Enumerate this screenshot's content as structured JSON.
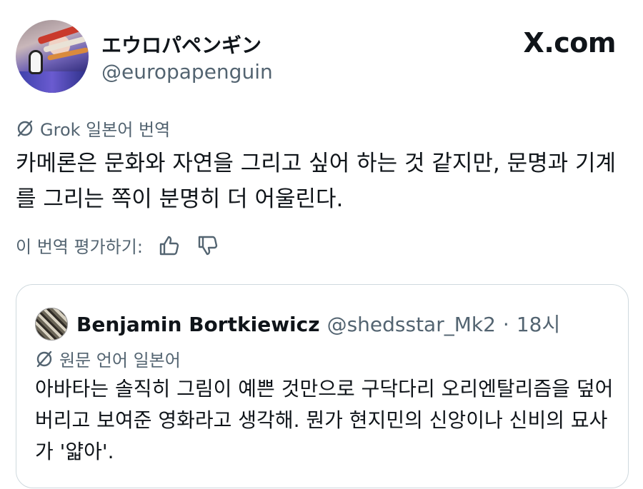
{
  "post": {
    "author": {
      "display_name": "エウロパペンギン",
      "handle": "@europapenguin"
    },
    "site_logo": "X.com",
    "translation_label": "Grok 일본어 번역",
    "translated_text": "카메론은 문화와 자연을 그리고 싶어 하는 것 같지만, 문명과 기계를 그리는 쪽이 분명히 더 어울린다.",
    "rate_label": "이 번역 평가하기:",
    "icons": {
      "grok": "grok-icon",
      "thumbs_up": "thumbs-up-icon",
      "thumbs_down": "thumbs-down-icon"
    }
  },
  "quoted": {
    "author": {
      "display_name": "Benjamin Bortkiewicz",
      "handle": "@shedsstar_Mk2",
      "separator": "·",
      "time": "18시"
    },
    "language_label": "원문 언어 일본어",
    "text": "아바타는 솔직히 그림이 예쁜 것만으로 구닥다리 오리엔탈리즘을 덮어버리고 보여준 영화라고 생각해. 뭔가 현지민의 신앙이나 신비의 묘사가 '얇아'."
  },
  "colors": {
    "primary_text": "#0f1419",
    "secondary_text": "#536471",
    "border": "#cfd9de",
    "background": "#ffffff"
  }
}
